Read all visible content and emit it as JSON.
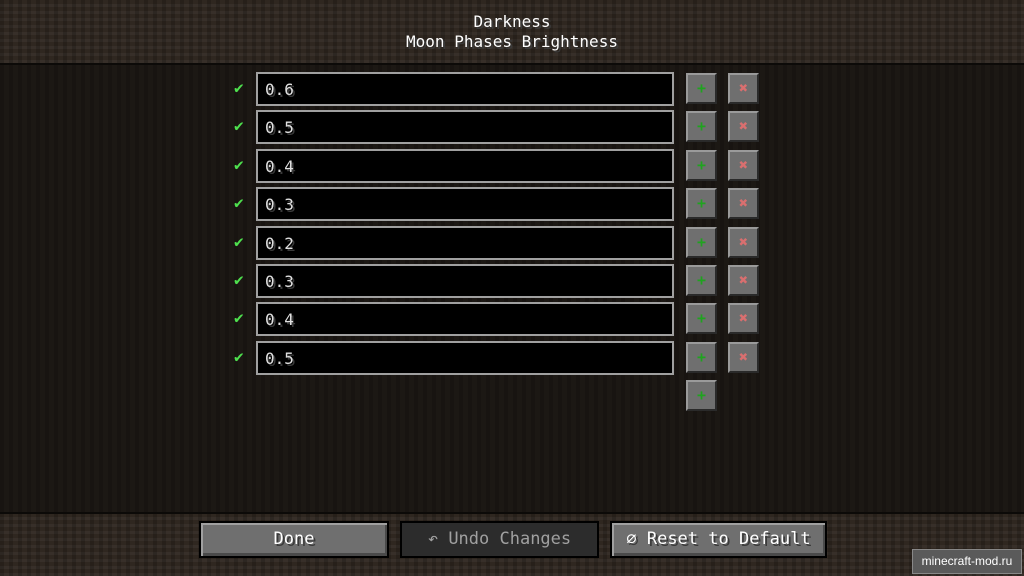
{
  "header": {
    "title": "Darkness",
    "subtitle": "Moon Phases Brightness"
  },
  "entries": [
    {
      "value": "0.6"
    },
    {
      "value": "0.5"
    },
    {
      "value": "0.4"
    },
    {
      "value": "0.3"
    },
    {
      "value": "0.2"
    },
    {
      "value": "0.3"
    },
    {
      "value": "0.4"
    },
    {
      "value": "0.5"
    }
  ],
  "icons": {
    "valid": "✔",
    "add": "+",
    "remove": "✖"
  },
  "footer": {
    "done": "Done",
    "undo": "↶ Undo Changes",
    "reset": "⌀ Reset to Default"
  },
  "watermark": "minecraft-mod.ru",
  "colors": {
    "valid": "#4ee04e",
    "add": "#1fa31f",
    "remove": "#d96f6f"
  }
}
